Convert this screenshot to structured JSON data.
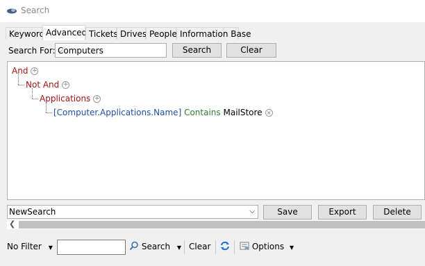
{
  "window": {
    "title": "Search"
  },
  "tabs": [
    {
      "label": "Keyword"
    },
    {
      "label": "Advanced",
      "active": true
    },
    {
      "label": "Tickets"
    },
    {
      "label": "Drives"
    },
    {
      "label": "People"
    },
    {
      "label": "Information Base"
    }
  ],
  "search_for": {
    "label": "Search For:",
    "value": "Computers",
    "search_button": "Search",
    "clear_button": "Clear"
  },
  "tree": {
    "root": "And",
    "child": "Not And",
    "grandchild": "Applications",
    "condition": {
      "field": "[Computer.Applications.Name]",
      "operator": "Contains",
      "value": "MailStore"
    }
  },
  "saved_search": {
    "value": "NewSearch",
    "save_button": "Save",
    "export_button": "Export",
    "delete_button": "Delete"
  },
  "bottom_bar": {
    "filter": "No Filter",
    "search": "Search",
    "clear": "Clear",
    "options": "Options"
  },
  "colors": {
    "keyword": "#a31515",
    "field": "#1f4fa3",
    "operator": "#2e7d32"
  },
  "icons": [
    "search-window-icon",
    "add-node-icon",
    "remove-node-icon",
    "dropdown-arrow-icon",
    "magnifier-icon",
    "refresh-icon",
    "options-icon",
    "scroll-left-icon"
  ]
}
